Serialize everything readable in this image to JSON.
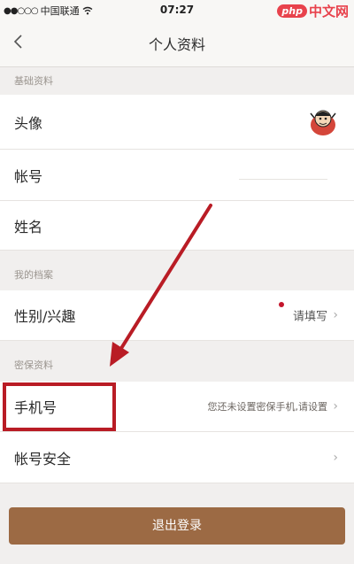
{
  "status_bar": {
    "signal": "●●○○○",
    "carrier": "中国联通",
    "time": "07:27"
  },
  "watermark": {
    "badge": "php",
    "text": "中文网"
  },
  "nav": {
    "back_icon": "chevron-left-icon",
    "title": "个人资料"
  },
  "sections": {
    "basic": "基础资料",
    "profile": "我的档案",
    "security": "密保资料"
  },
  "rows": {
    "avatar": {
      "label": "头像"
    },
    "account": {
      "label": "帐号"
    },
    "name": {
      "label": "姓名"
    },
    "gender_interest": {
      "label": "性别/兴趣",
      "value": "请填写"
    },
    "phone": {
      "label": "手机号",
      "value": "您还未设置密保手机,请设置"
    },
    "account_security": {
      "label": "帐号安全"
    }
  },
  "logout": {
    "label": "退出登录"
  },
  "colors": {
    "annotation_red": "#b91c25",
    "logout_brown": "#9c6a44",
    "dot_red": "#c4162c"
  }
}
